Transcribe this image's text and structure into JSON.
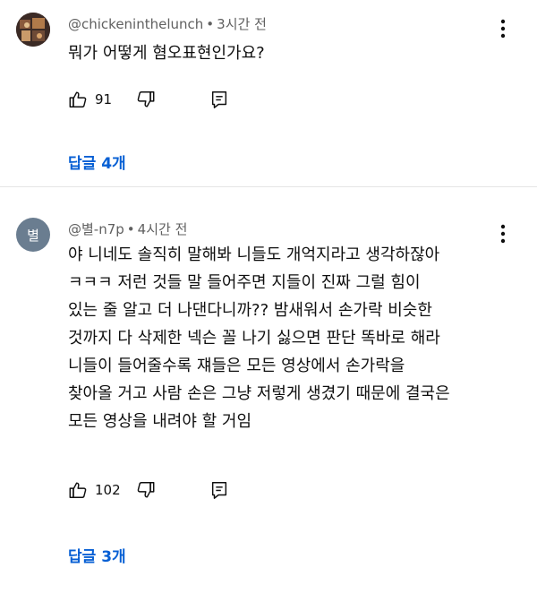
{
  "comments": [
    {
      "author": "@chickeninthelunch",
      "separator": "•",
      "time": "3시간 전",
      "text": "뭐가 어떻게 혐오표현인가요?",
      "likes": "91",
      "replies_label": "답글 4개"
    },
    {
      "avatar_text": "별",
      "author": "@별-n7p",
      "separator": "•",
      "time": "4시간 전",
      "text": "야 니네도 솔직히 말해봐 니들도 개억지라고 생각하잖아\nㅋㅋㅋ 저런 것들 말 들어주면 지들이 진짜 그럴 힘이\n있는 줄 알고 더 나댄다니까?? 밤새워서 손가락 비슷한\n것까지 다 삭제한 넥슨 꼴 나기 싫으면 판단 똑바로 해라\n니들이 들어줄수록 쟤들은 모든 영상에서 손가락을\n찾아올 거고 사람 손은 그냥 저렇게 생겼기 때문에 결국은\n모든 영상을 내려야 할 거임",
      "likes": "102",
      "replies_label": "답글 3개"
    }
  ],
  "icons": {
    "like": "thumbs-up-icon",
    "dislike": "thumbs-down-icon",
    "reply": "reply-comment-icon",
    "menu": "more-vert-icon"
  },
  "colors": {
    "link": "#065fd4",
    "meta_text": "#606060",
    "body_text": "#0f0f0f",
    "avatar_bg": "#6a7d90"
  }
}
